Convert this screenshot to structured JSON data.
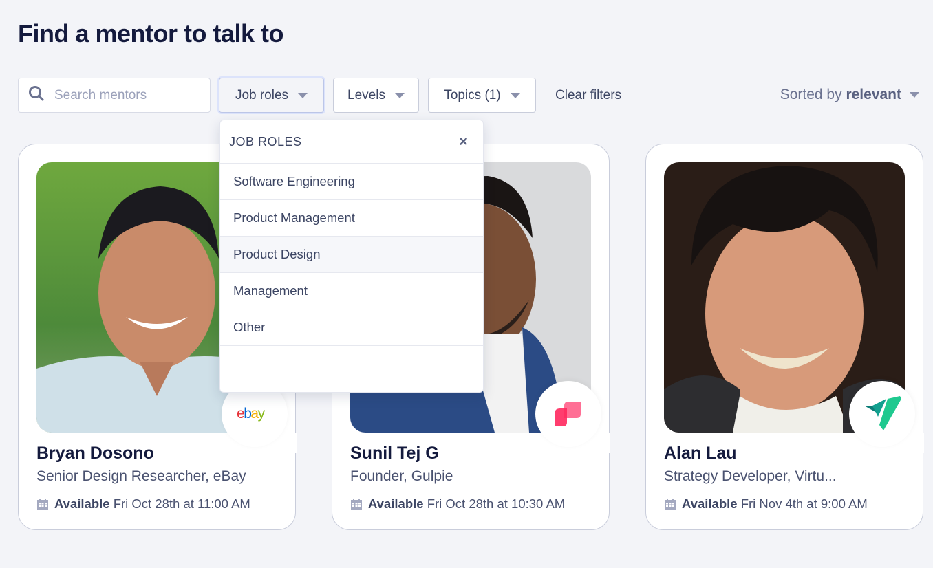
{
  "page": {
    "title": "Find a mentor to talk to"
  },
  "toolbar": {
    "search": {
      "placeholder": "Search mentors",
      "value": ""
    },
    "filters": [
      {
        "label": "Job roles",
        "active": true
      },
      {
        "label": "Levels",
        "active": false
      },
      {
        "label": "Topics (1)",
        "active": false
      }
    ],
    "clear_filters_label": "Clear filters",
    "sort": {
      "prefix": "Sorted by",
      "value": "relevant"
    }
  },
  "dropdown": {
    "title": "JOB ROLES",
    "close_icon": "×",
    "options": [
      {
        "label": "Software Engineering"
      },
      {
        "label": "Product Management"
      },
      {
        "label": "Product Design",
        "hovered": true
      },
      {
        "label": "Management"
      },
      {
        "label": "Other"
      }
    ]
  },
  "mentors": [
    {
      "name": "Bryan Dosono",
      "role": "Senior Design Researcher, eBay",
      "company_logo": "ebay-logo",
      "available_label": "Available",
      "available_time": "Fri Oct 28th at 11:00 AM"
    },
    {
      "name": "Sunil Tej G",
      "role": "Founder, Gulpie",
      "company_logo": "gulpie-logo",
      "available_label": "Available",
      "available_time": "Fri Oct 28th at 10:30 AM"
    },
    {
      "name": "Alan Lau",
      "role": "Strategy Developer, Virtu...",
      "company_logo": "virtu-logo",
      "available_label": "Available",
      "available_time": "Fri Nov 4th at 9:00 AM"
    }
  ],
  "colors": {
    "background": "#f3f4f8",
    "title": "#141a3d",
    "text": "#3c4563",
    "gulpie_pink": "#ff3d6e",
    "virtu_green": "#1fc98f",
    "virtu_teal": "#0d8c83"
  }
}
